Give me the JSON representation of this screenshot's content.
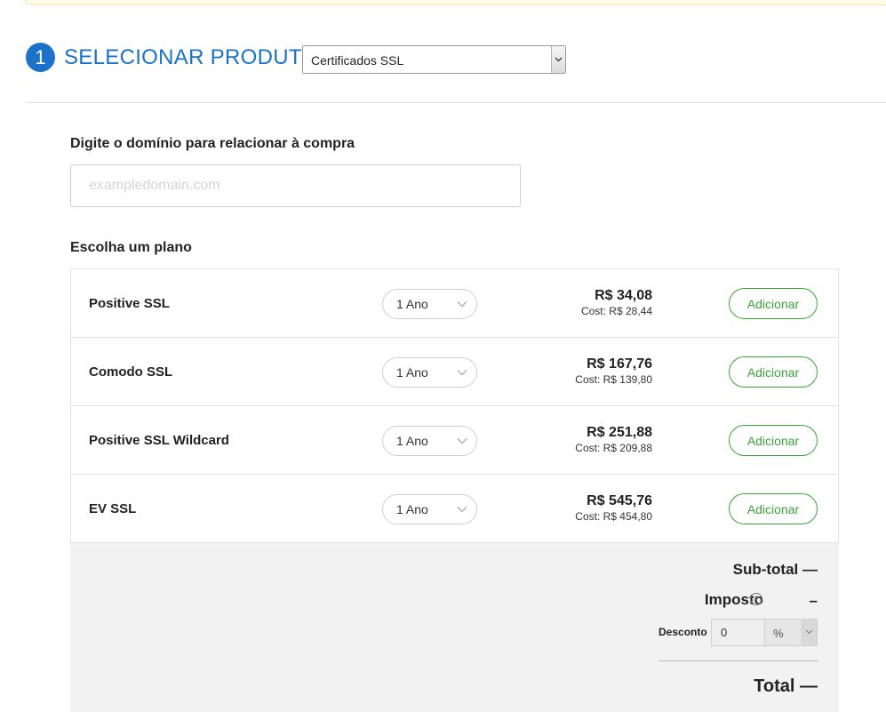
{
  "step": {
    "number": "1",
    "title": "SELECIONAR PRODUTO:"
  },
  "product_select": {
    "value": "Certificados SSL"
  },
  "domain": {
    "label": "Digite o domínio para relacionar à compra",
    "placeholder": "exampledomain.com",
    "value": ""
  },
  "plans": {
    "label": "Escolha um plano",
    "items": [
      {
        "name": "Positive SSL",
        "period": "1 Ano",
        "price": "R$ 34,08",
        "cost": "Cost: R$ 28,44",
        "button": "Adicionar"
      },
      {
        "name": "Comodo SSL",
        "period": "1 Ano",
        "price": "R$ 167,76",
        "cost": "Cost: R$ 139,80",
        "button": "Adicionar"
      },
      {
        "name": "Positive SSL Wildcard",
        "period": "1 Ano",
        "price": "R$ 251,88",
        "cost": "Cost: R$ 209,88",
        "button": "Adicionar"
      },
      {
        "name": "EV SSL",
        "period": "1 Ano",
        "price": "R$ 545,76",
        "cost": "Cost: R$ 454,80",
        "button": "Adicionar"
      }
    ]
  },
  "summary": {
    "subtotal": "Sub-total —",
    "tax_label": "Imposto",
    "tax_help": "?",
    "tax_value": "–",
    "discount_label": "Desconto",
    "discount_value": "0",
    "discount_unit": "%",
    "total": "Total —"
  },
  "colors": {
    "accent": "#1a73c9",
    "button": "#3aa33a",
    "summary_bg": "#f2f2f2"
  },
  "icons": {
    "select_arrow": "chevron-down-icon",
    "help": "question-circle-icon"
  }
}
